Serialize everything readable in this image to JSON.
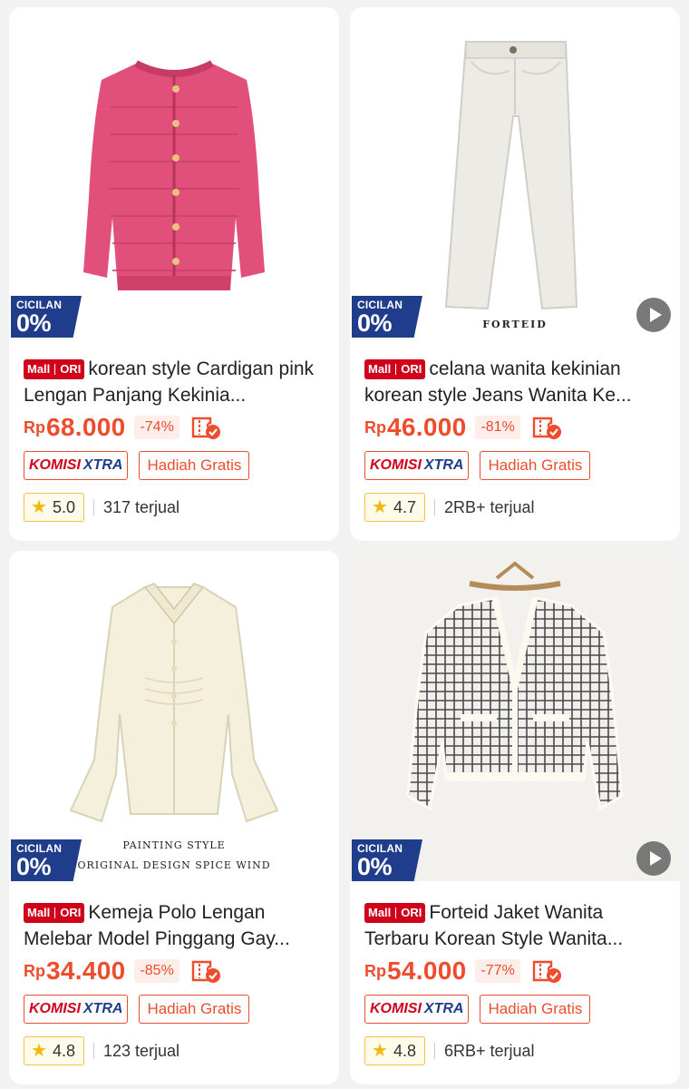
{
  "products": [
    {
      "mall_badge": {
        "mall": "Mall",
        "ori": "ORI"
      },
      "title": "korean style Cardigan pink Lengan Panjang Kekinia...",
      "currency": "Rp",
      "price": "68.000",
      "discount": "-74%",
      "tags": {
        "komisi_1": "KOMISI",
        "komisi_2": "XTRA",
        "gift": "Hadiah Gratis"
      },
      "rating": "5.0",
      "sold": "317 terjual",
      "cicilan": {
        "top": "CICILAN",
        "big": "0%"
      },
      "has_video": false,
      "image_caption": "",
      "image_icon": "pink-cardigan"
    },
    {
      "mall_badge": {
        "mall": "Mall",
        "ori": "ORI"
      },
      "title": "celana wanita kekinian korean style Jeans Wanita Ke...",
      "currency": "Rp",
      "price": "46.000",
      "discount": "-81%",
      "tags": {
        "komisi_1": "KOMISI",
        "komisi_2": "XTRA",
        "gift": "Hadiah Gratis"
      },
      "rating": "4.7",
      "sold": "2RB+ terjual",
      "cicilan": {
        "top": "CICILAN",
        "big": "0%"
      },
      "has_video": true,
      "image_caption": "FORTEID",
      "image_icon": "white-jeans"
    },
    {
      "mall_badge": {
        "mall": "Mall",
        "ori": "ORI"
      },
      "title": "Kemeja Polo Lengan Melebar Model Pinggang Gay...",
      "currency": "Rp",
      "price": "34.400",
      "discount": "-85%",
      "tags": {
        "komisi_1": "KOMISI",
        "komisi_2": "XTRA",
        "gift": "Hadiah Gratis"
      },
      "rating": "4.8",
      "sold": "123 terjual",
      "cicilan": {
        "top": "CICILAN",
        "big": "0%"
      },
      "has_video": false,
      "image_caption": "PAINTING STYLE",
      "image_caption_2": "ORIGINAL DESIGN SPICE WIND",
      "image_icon": "cream-blouse"
    },
    {
      "mall_badge": {
        "mall": "Mall",
        "ori": "ORI"
      },
      "title": "Forteid Jaket Wanita Terbaru Korean Style  Wanita...",
      "currency": "Rp",
      "price": "54.000",
      "discount": "-77%",
      "tags": {
        "komisi_1": "KOMISI",
        "komisi_2": "XTRA",
        "gift": "Hadiah Gratis"
      },
      "rating": "4.8",
      "sold": "6RB+ terjual",
      "cicilan": {
        "top": "CICILAN",
        "big": "0%"
      },
      "has_video": true,
      "image_caption": "",
      "image_icon": "tweed-jacket"
    }
  ],
  "colors": {
    "accent": "#ee4d2d",
    "mall_red": "#d0011b",
    "cicilan_blue": "#1f3d8a",
    "star": "#f5b70a"
  }
}
